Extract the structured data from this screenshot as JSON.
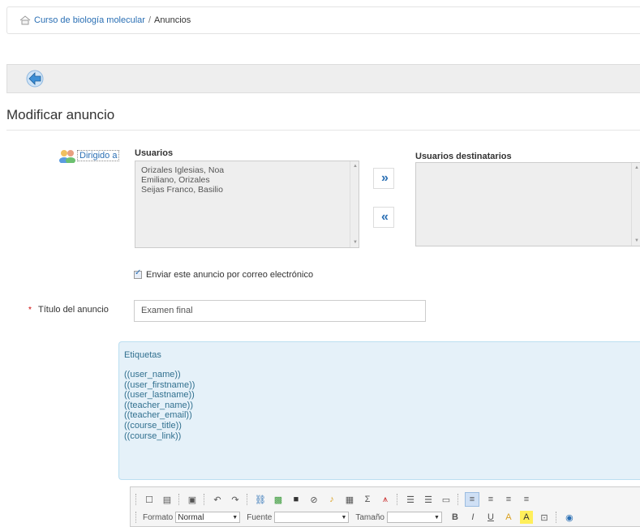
{
  "breadcrumb": {
    "course_link": "Curso de biología molecular",
    "separator": "/",
    "current": "Anuncios"
  },
  "toolbar": {
    "back_icon": "back-arrow-icon"
  },
  "page_title": "Modificar anuncio",
  "recipients": {
    "dirigido_label": "Dirigido a",
    "users_label": "Usuarios",
    "users": [
      "Orizales Iglesias, Noa",
      "Emiliano, Orizales",
      "Seijas Franco, Basilio"
    ],
    "target_label": "Usuarios destinatarios",
    "target_users": [],
    "add_label": "»",
    "remove_label": "«"
  },
  "email_checkbox": {
    "label": "Enviar este anuncio por correo electrónico",
    "checked": true
  },
  "title_field": {
    "required_mark": "*",
    "label": "Título del anuncio",
    "value": "Examen final"
  },
  "tags": {
    "header": "Etiquetas",
    "items": [
      "((user_name))",
      "((user_firstname))",
      "((user_lastname))",
      "((teacher_name))",
      "((teacher_email))",
      "((course_title))",
      "((course_link))"
    ]
  },
  "editor": {
    "format_label": "Formato",
    "format_value": "Normal",
    "font_label": "Fuente",
    "font_value": "",
    "size_label": "Tamaño",
    "size_value": "",
    "bold": "B",
    "italic": "I",
    "underline": "U",
    "sigma": "Σ"
  },
  "colors": {
    "link": "#2a6fb4",
    "tags_bg": "#e5f1f9",
    "tags_text": "#31708f",
    "required": "#cc0000"
  }
}
